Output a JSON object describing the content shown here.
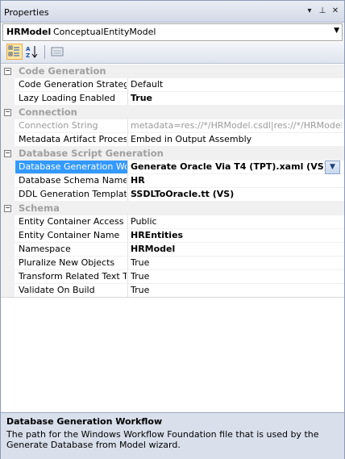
{
  "window": {
    "title": "Properties",
    "buttons": {
      "dropdown": "▾",
      "pin": "⊥",
      "close": "✕"
    }
  },
  "object_selector": {
    "name": "HRModel",
    "type": "ConceptualEntityModel"
  },
  "toolbar": {
    "categorized_icon": "categorized-icon",
    "alphabetical_icon": "alphabetical-icon",
    "property_pages_icon": "property-pages-icon"
  },
  "grid": {
    "categories": [
      {
        "label": "Code Generation",
        "properties": [
          {
            "name": "Code Generation Strategy",
            "value": "Default"
          },
          {
            "name": "Lazy Loading Enabled",
            "value": "True"
          }
        ]
      },
      {
        "label": "Connection",
        "properties": [
          {
            "name": "Connection String",
            "value": "metadata=res://*/HRModel.csdl|res://*/HRModel.ssdl"
          },
          {
            "name": "Metadata Artifact Processin",
            "value": "Embed in Output Assembly"
          }
        ]
      },
      {
        "label": "Database Script Generation",
        "properties": [
          {
            "name": "Database Generation Workfl",
            "value": "Generate Oracle Via T4 (TPT).xaml (VS)"
          },
          {
            "name": "Database Schema Name",
            "value": "HR"
          },
          {
            "name": "DDL Generation Template",
            "value": "SSDLToOracle.tt (VS)"
          }
        ]
      },
      {
        "label": "Schema",
        "properties": [
          {
            "name": "Entity Container Access",
            "value": "Public"
          },
          {
            "name": "Entity Container Name",
            "value": "HREntities"
          },
          {
            "name": "Namespace",
            "value": "HRModel"
          },
          {
            "name": "Pluralize New Objects",
            "value": "True"
          },
          {
            "name": "Transform Related Text Ten",
            "value": "True"
          },
          {
            "name": "Validate On Build",
            "value": "True"
          }
        ]
      }
    ]
  },
  "description": {
    "title": "Database Generation Workflow",
    "text": "The path for the Windows Workflow Foundation file that is used by the Generate Database from Model wizard."
  },
  "colors": {
    "selection": "#3399ff",
    "category_text": "#a0a0a0",
    "description_bg": "#d9dfeb"
  }
}
